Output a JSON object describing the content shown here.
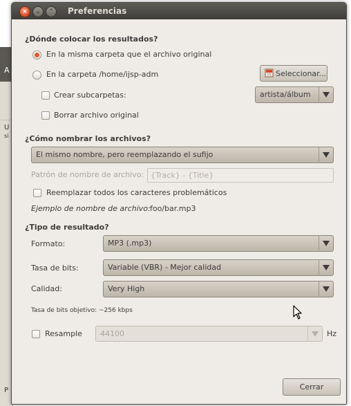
{
  "background_window": {
    "title_letter": "A",
    "row_letter": "U",
    "row_sub": "si",
    "bottom_letter": "P"
  },
  "dialog": {
    "title": "Preferencias",
    "close_glyph": "×",
    "min_glyph": "⌄",
    "max_glyph": "⌃"
  },
  "destination": {
    "heading": "¿Dónde colocar los resultados?",
    "same_folder_label": "En la misma carpeta que el archivo original",
    "folder_label": "En la carpeta /home/ijsp-adm",
    "select_button": "Seleccionar...",
    "subfolders_label": "Crear subcarpetas:",
    "subfolders_combo": "artista/álbum",
    "delete_original_label": "Borrar archivo original"
  },
  "naming": {
    "heading": "¿Cómo nombrar los archivos?",
    "naming_combo": "El mismo nombre, pero reemplazando el sufijo",
    "pattern_label": "Patrón de nombre de archivo:",
    "pattern_value": "{Track} - {Title}",
    "replace_chars_label": "Reemplazar todos los caracteres problemáticos",
    "example_label": "Ejemplo de nombre de archivo:",
    "example_value": "foo/bar.mp3"
  },
  "result_type": {
    "heading": "¿Tipo de resultado?",
    "format_label": "Formato:",
    "format_value": "MP3 (.mp3)",
    "bitrate_label": "Tasa de bits:",
    "bitrate_value": "Variable (VBR) - Mejor calidad",
    "quality_label": "Calidad:",
    "quality_value": "Very High",
    "target_bitrate": "Tasa de bits objetivo: ~256 kbps",
    "resample_label": "Resample",
    "resample_value": "44100",
    "resample_unit": "Hz"
  },
  "footer": {
    "close_button": "Cerrar"
  },
  "colors": {
    "dialog_bg": "#efebe6",
    "titlebar": "#3e3d39",
    "accent": "#e05a2b"
  }
}
